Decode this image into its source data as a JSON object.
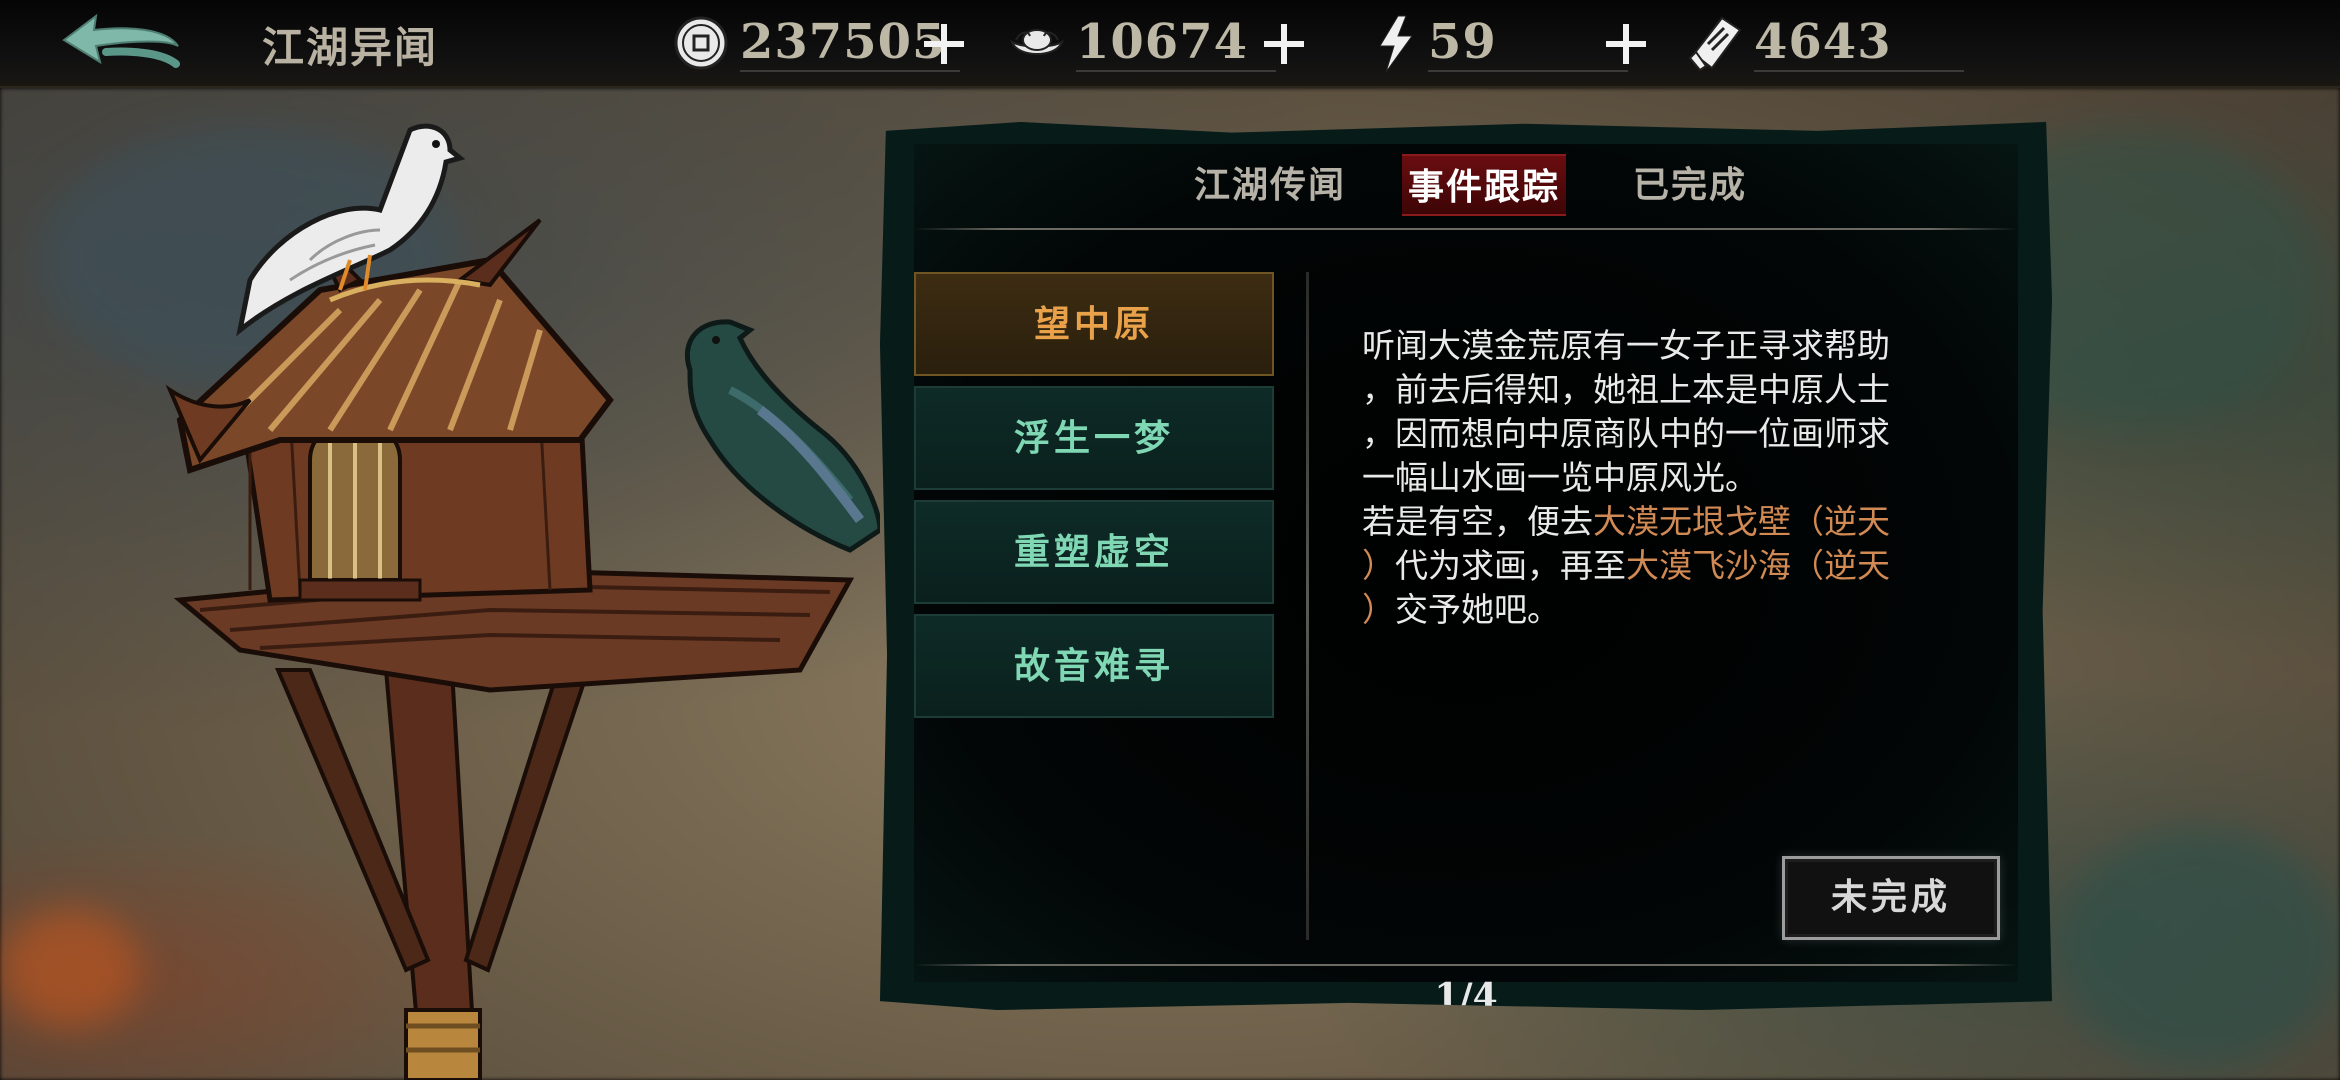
{
  "header": {
    "title": "江湖异闻",
    "resources": [
      {
        "icon": "copper-coin-icon",
        "value": "237505"
      },
      {
        "icon": "silver-ingot-icon",
        "value": "10674"
      },
      {
        "icon": "lightning-energy-icon",
        "value": "59"
      },
      {
        "icon": "ticket-scroll-icon",
        "value": "4643"
      }
    ]
  },
  "tabs": [
    {
      "label": "江湖传闻",
      "active": false
    },
    {
      "label": "事件跟踪",
      "active": true
    },
    {
      "label": "已完成",
      "active": false
    }
  ],
  "quests": [
    {
      "label": "望中原",
      "selected": true
    },
    {
      "label": "浮生一梦",
      "selected": false
    },
    {
      "label": "重塑虚空",
      "selected": false
    },
    {
      "label": "故音难寻",
      "selected": false
    }
  ],
  "description": {
    "line1": "听闻大漠金荒原有一女子正寻求帮助",
    "line2": "，前去后得知，她祖上本是中原人士",
    "line3": "，因而想向中原商队中的一位画师求",
    "line4": "一幅山水画一览中原风光。",
    "line5_pre": "若是有空，便去",
    "line5_hl": "大漠无垠戈壁（逆天",
    "line6_hl1": "）",
    "line6_mid": "代为求画，再至",
    "line6_hl2": "大漠飞沙海（逆天",
    "line7_hl": "）",
    "line7_post": "交予她吧。"
  },
  "status_button": "未完成",
  "pager": "1/4",
  "colors": {
    "accent_tab": "#6a0d10",
    "quest_text": "#7fd7b4",
    "quest_selected_text": "#e9a24a",
    "highlight_text": "#d18a53",
    "panel_bg": "#071b19"
  }
}
